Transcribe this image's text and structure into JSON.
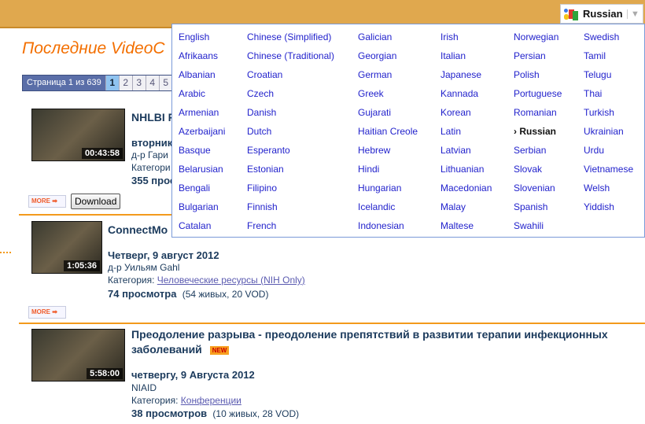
{
  "header": {
    "selected_language": "Russian",
    "dropdown_arrow": "▼",
    "colors": {
      "bar": "#e0a84e",
      "accent": "#f36f00"
    }
  },
  "page": {
    "title": "Последние VideoC",
    "pager": {
      "label": "Страница 1 из 639",
      "pages": [
        "1",
        "2",
        "3",
        "4",
        "5"
      ],
      "current": "1"
    }
  },
  "videos": [
    {
      "title": "NHLBI F",
      "duration": "00:43:58",
      "date": "вторник",
      "speaker": "д-р Гари",
      "category_label": "Категори",
      "views": "355 прос",
      "more": "MORE",
      "download": "Download"
    },
    {
      "title": "ConnectMo",
      "duration": "1:05:36",
      "date": "Четверг, 9 август 2012",
      "speaker": "д-р Уильям Gahl",
      "category_label": "Категория:",
      "category": "Человеческие ресурсы (NIH Only)",
      "views": "74 просмотра",
      "views_detail": "(54 живых, 20 VOD)",
      "more": "MORE"
    },
    {
      "title": "Преодоление разрыва - преодоление препятствий в развитии терапии инфекционных",
      "title2": "заболеваний",
      "badge": "NEW",
      "duration": "5:58:00",
      "date": "четвергу, 9 Августа 2012",
      "speaker": "NIAID",
      "category_label": "Категория:",
      "category": "Конференции",
      "views": "38 просмотров",
      "views_detail": "(10 живых, 28 VOD)"
    }
  ],
  "languages": [
    [
      "English",
      "Afrikaans",
      "Albanian",
      "Arabic",
      "Armenian",
      "Azerbaijani",
      "Basque",
      "Belarusian",
      "Bengali",
      "Bulgarian",
      "Catalan"
    ],
    [
      "Chinese (Simplified)",
      "Chinese (Traditional)",
      "Croatian",
      "Czech",
      "Danish",
      "Dutch",
      "Esperanto",
      "Estonian",
      "Filipino",
      "Finnish",
      "French"
    ],
    [
      "Galician",
      "Georgian",
      "German",
      "Greek",
      "Gujarati",
      "Haitian Creole",
      "Hebrew",
      "Hindi",
      "Hungarian",
      "Icelandic",
      "Indonesian"
    ],
    [
      "Irish",
      "Italian",
      "Japanese",
      "Kannada",
      "Korean",
      "Latin",
      "Latvian",
      "Lithuanian",
      "Macedonian",
      "Malay",
      "Maltese"
    ],
    [
      "Norwegian",
      "Persian",
      "Polish",
      "Portuguese",
      "Romanian",
      "› Russian",
      "Serbian",
      "Slovak",
      "Slovenian",
      "Spanish",
      "Swahili"
    ],
    [
      "Swedish",
      "Tamil",
      "Telugu",
      "Thai",
      "Turkish",
      "Ukrainian",
      "Urdu",
      "Vietnamese",
      "Welsh",
      "Yiddish"
    ]
  ]
}
